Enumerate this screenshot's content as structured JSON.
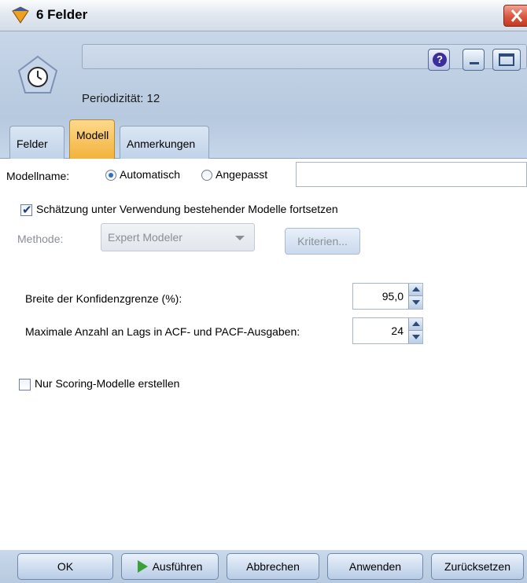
{
  "window": {
    "title": "6 Felder",
    "close_icon": "close-icon",
    "accent": "#f3b23c"
  },
  "header": {
    "node_icon": "clock-pentagon-icon",
    "name_value": "",
    "periodicity": "Periodizität: 12",
    "help_icon": "help-icon",
    "minimize_icon": "minimize-icon",
    "maximize_icon": "maximize-icon"
  },
  "tabs": [
    {
      "label": "Felder",
      "active": false
    },
    {
      "label": "Modell",
      "active": true
    },
    {
      "label": "Anmerkungen",
      "active": false
    }
  ],
  "model": {
    "modelname_label": "Modellname:",
    "radio_auto": "Automatisch",
    "radio_custom": "Angepasst",
    "radio_selected": "Automatisch",
    "custom_name_value": "",
    "continue_checkbox": "Schätzung unter Verwendung bestehender Modelle fortsetzen",
    "continue_checked": true,
    "method_label": "Methode:",
    "method_value": "Expert Modeler",
    "criteria_button": "Kriterien...",
    "confidence_label": "Breite der Konfidenzgrenze (%):",
    "confidence_value": "95,0",
    "lags_label": "Maximale Anzahl an Lags in ACF- und PACF-Ausgaben:",
    "lags_value": "24",
    "scoring_checkbox": "Nur Scoring-Modelle erstellen",
    "scoring_checked": false
  },
  "footer": {
    "ok": "OK",
    "run": "Ausführen",
    "run_icon": "play-icon",
    "cancel": "Abbrechen",
    "apply": "Anwenden",
    "reset": "Zurücksetzen"
  }
}
